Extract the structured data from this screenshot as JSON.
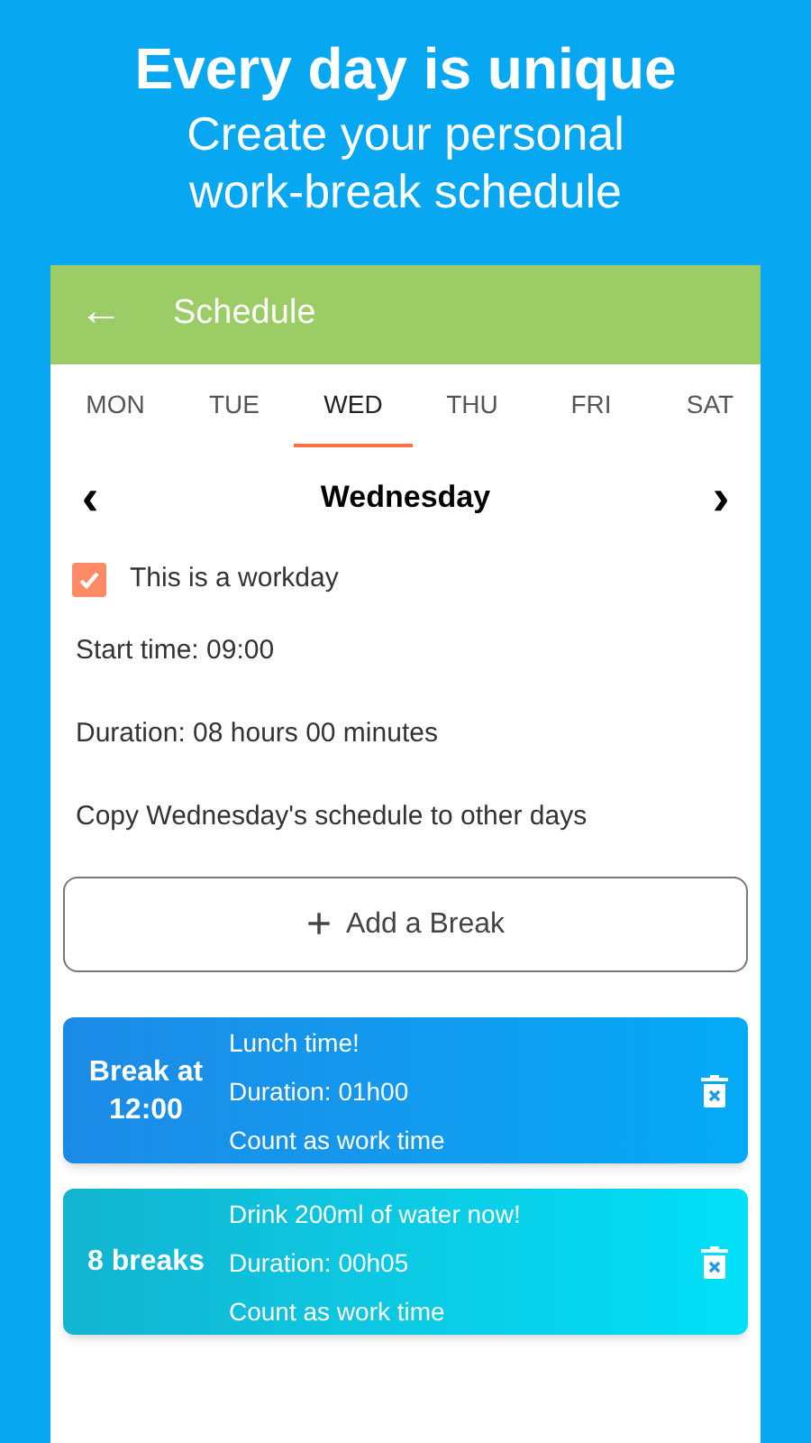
{
  "promo": {
    "headline": "Every day is unique",
    "subline": "Create your personal work-break schedule"
  },
  "app_bar": {
    "back_icon": "←",
    "title": "Schedule"
  },
  "tabs": [
    {
      "label": "MON",
      "selected": false
    },
    {
      "label": "TUE",
      "selected": false
    },
    {
      "label": "WED",
      "selected": true
    },
    {
      "label": "THU",
      "selected": false
    },
    {
      "label": "FRI",
      "selected": false
    },
    {
      "label": "SAT",
      "selected": false
    }
  ],
  "day_nav": {
    "prev": "‹",
    "title": "Wednesday",
    "next": "›"
  },
  "workday": {
    "label": "This is a workday",
    "checked": true
  },
  "settings": [
    "Start time: 09:00",
    "Duration: 08 hours 00 minutes",
    "Copy Wednesday's schedule to other days"
  ],
  "add_button": {
    "icon": "+",
    "label": "Add a Break"
  },
  "breaks": [
    {
      "kind": "fixed",
      "badge": "Break at 12:00",
      "title": "Lunch time!",
      "duration": "Duration: 01h00",
      "note": "Count as work time"
    },
    {
      "kind": "repeat",
      "badge": "8 breaks",
      "title": "Drink 200ml of water now!",
      "duration": "Duration: 00h05",
      "note": "Count as work time"
    }
  ]
}
